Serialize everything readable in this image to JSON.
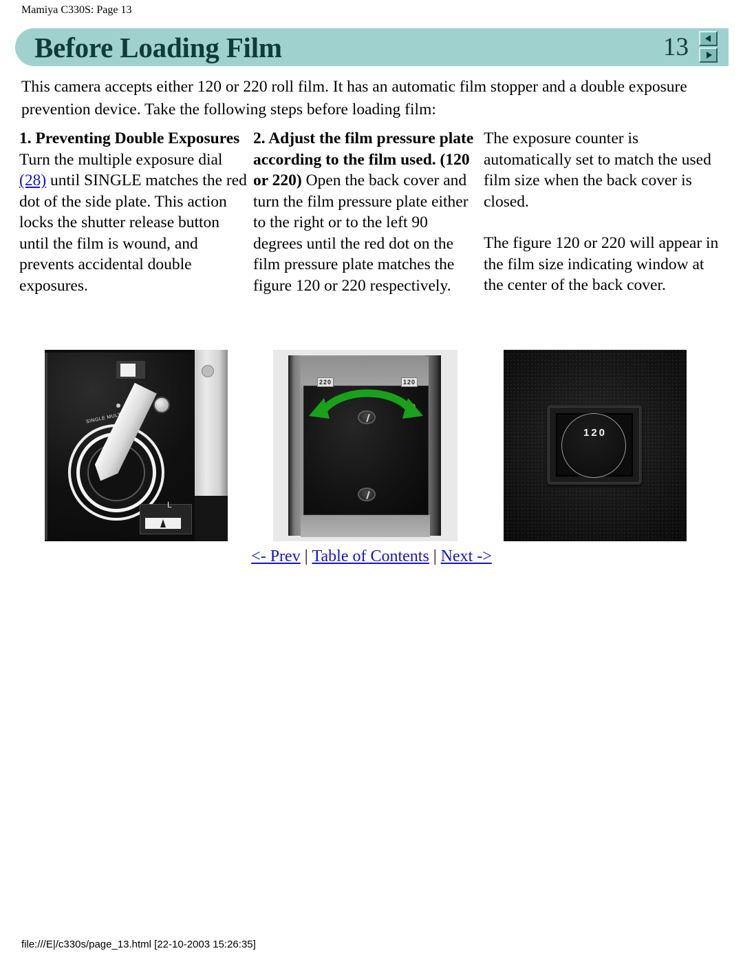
{
  "document": {
    "running_head": "Mamiya C330S: Page 13",
    "footer": "file:///E|/c330s/page_13.html [22-10-2003 15:26:35]"
  },
  "banner": {
    "title": "Before Loading Film",
    "page_number": "13",
    "background_color": "#9fd2cf",
    "text_color": "#103b3b",
    "nav": [
      {
        "name": "prev-page-arrow",
        "icon": "triangle-left-icon"
      },
      {
        "name": "next-page-arrow",
        "icon": "triangle-right-icon"
      }
    ]
  },
  "intro": {
    "text": "This camera accepts either 120 or 220 roll film. It has an automatic film stopper and a double exposure prevention device. Take the following steps before loading film:"
  },
  "columns": {
    "col1": {
      "heading": "1. Preventing Double Exposures",
      "body_before_link": " Turn the multiple exposure dial ",
      "link_label": "(28)",
      "body_after_link": " until SINGLE matches the red dot of the side plate. This action locks the shutter release button until the film is wound, and prevents accidental double exposures."
    },
    "col2": {
      "heading": "2. Adjust the film pressure plate according to the film used. (120 or 220)",
      "body": " Open the back cover and turn the film pressure plate either to the right or to the left 90 degrees until the red dot on the film pressure plate matches the figure 120 or 220 respectively."
    },
    "col3": {
      "para1": "The exposure counter is automatically set to match the used film size when the back cover is closed.",
      "para2": "The figure 120 or 220 will appear in the film size indicating window at the center of the back cover."
    }
  },
  "figures": [
    {
      "name": "figure-side-plate-multiple-exposure-dial",
      "caption": "",
      "labels": {
        "scale": "SINGLE  MULTI",
        "lock": "L"
      }
    },
    {
      "name": "figure-film-pressure-plate",
      "caption": "",
      "labels": {
        "left": "220",
        "right": "120"
      },
      "arrow_color": "#1aa11a"
    },
    {
      "name": "figure-film-size-indicating-window",
      "caption": "",
      "labels": {
        "window_value": "120"
      }
    }
  ],
  "page_nav": {
    "prev_label": "<- Prev",
    "toc_label": "Table of Contents",
    "next_label": "Next ->",
    "separator": "|",
    "link_color": "#1414c8"
  }
}
